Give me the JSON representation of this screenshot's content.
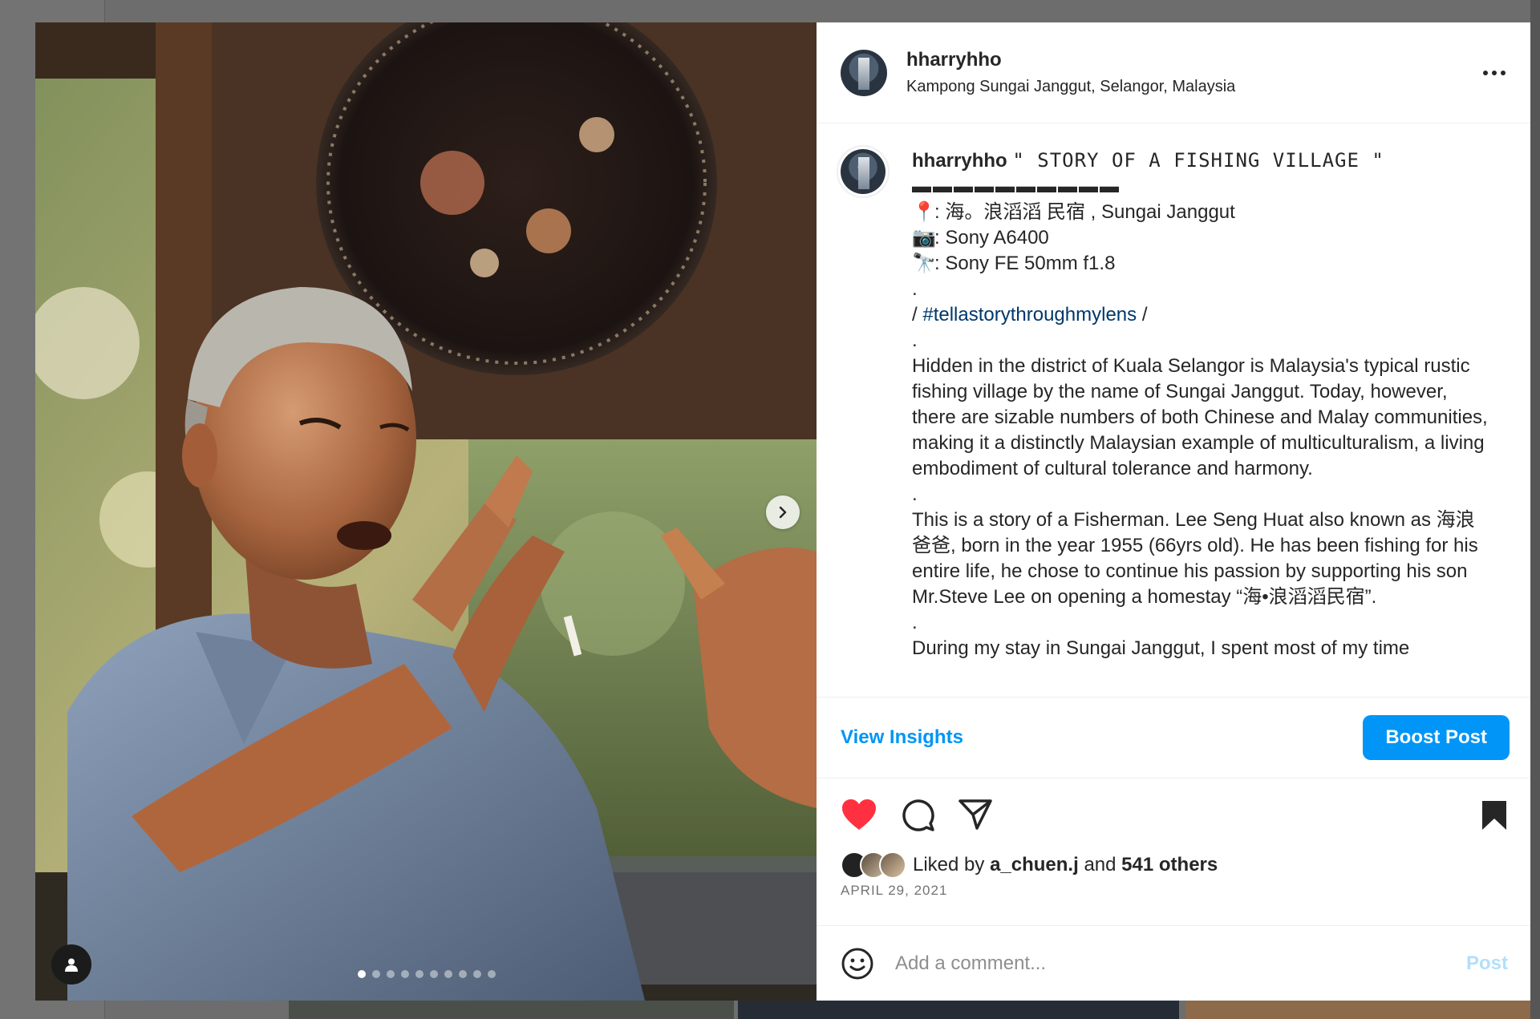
{
  "post": {
    "username": "hharryhho",
    "location": "Kampong Sungai Janggut, Selangor, Malaysia",
    "more_label": "•••"
  },
  "caption": {
    "username": "hharryhho",
    "title": "\" STORY OF A FISHING VILLAGE \"",
    "divider": "▬▬▬▬▬▬▬▬▬▬",
    "lines": [
      {
        "emoji": "📍",
        "text": ": 海。浪滔滔 民宿 , Sungai Janggut"
      },
      {
        "emoji": "📷",
        "text": ": Sony A6400"
      },
      {
        "emoji": "🔭",
        "text": ": Sony FE 50mm f1.8"
      }
    ],
    "dot": ".",
    "hashtag_prefix": "/ ",
    "hashtag": "#tellastorythroughmylens",
    "hashtag_suffix": " /",
    "paragraph1": "Hidden in the district of Kuala Selangor is Malaysia's typical rustic fishing village by the name of Sungai Janggut. Today, however, there are sizable numbers of both Chinese and Malay communities, making it a distinctly Malaysian example of multiculturalism, a living embodiment of cultural tolerance and harmony.",
    "paragraph2": "This is a story of a Fisherman. Lee Seng Huat also known as 海浪爸爸, born in the year 1955 (66yrs old). He has been fishing for his entire life, he chose to continue his passion by supporting his son Mr.Steve Lee on opening a homestay “海•浪滔滔民宿”.",
    "paragraph3_partial": "During my stay in Sungai Janggut, I spent most of my time"
  },
  "insights": {
    "view_label": "View Insights",
    "boost_label": "Boost Post"
  },
  "likes": {
    "prefix": "Liked by ",
    "first_liker": "a_chuen.j",
    "middle": " and ",
    "others": "541 others"
  },
  "date": "APRIL 29, 2021",
  "comment": {
    "placeholder": "Add a comment...",
    "post_label": "Post"
  },
  "carousel": {
    "total": 10,
    "active_index": 0
  },
  "colors": {
    "accent": "#0095f6",
    "like": "#ff3040",
    "hashtag": "#00376b",
    "muted": "#737373"
  },
  "icons": [
    "heart-icon",
    "comment-icon",
    "share-icon",
    "bookmark-icon",
    "more-icon",
    "chevron-right-icon",
    "user-tag-icon",
    "emoji-icon"
  ]
}
